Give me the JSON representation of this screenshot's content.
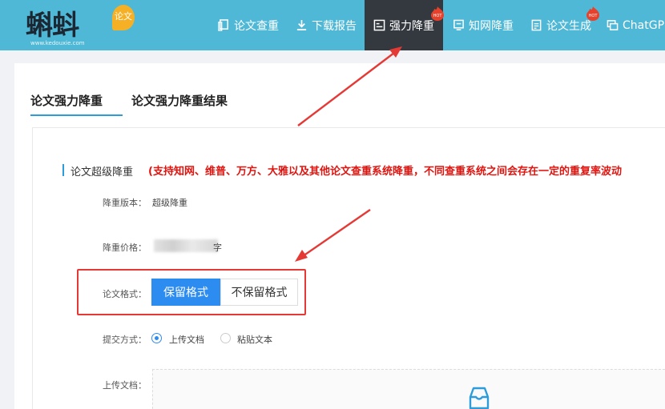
{
  "header": {
    "logo_text": "蝌蚪",
    "logo_badge": "论文",
    "logo_sub": "www.kedouxie.com",
    "nav": [
      {
        "label": "论文查重",
        "icon": "document-copy-icon",
        "active": false,
        "hot": false
      },
      {
        "label": "下载报告",
        "icon": "download-icon",
        "active": false,
        "hot": false
      },
      {
        "label": "强力降重",
        "icon": "reduce-icon",
        "active": true,
        "hot": true
      },
      {
        "label": "知网降重",
        "icon": "monitor-doc-icon",
        "active": false,
        "hot": false
      },
      {
        "label": "论文生成",
        "icon": "doc-generate-icon",
        "active": false,
        "hot": true
      },
      {
        "label": "ChatGP",
        "icon": "chat-icon",
        "active": false,
        "hot": false
      }
    ],
    "hot_label": "HOT"
  },
  "tabs": [
    {
      "label": "论文强力降重",
      "active": true
    },
    {
      "label": "论文强力降重结果",
      "active": false
    }
  ],
  "section": {
    "title": "论文超级降重",
    "note": "(支持知网、维普、万方、大雅以及其他论文查重系统降重，不同查重系统之间会存在一定的重复率波动"
  },
  "form": {
    "version_label": "降重版本：",
    "version_value": "超级降重",
    "price_label": "降重价格：",
    "price_value": "字",
    "format_label": "论文格式：",
    "format_options": [
      "保留格式",
      "不保留格式"
    ],
    "format_selected": "保留格式",
    "submit_label": "提交方式：",
    "submit_options": [
      "上传文档",
      "粘贴文本"
    ],
    "submit_selected": "上传文档",
    "upload_label": "上传文档："
  },
  "colors": {
    "header_bg": "#4fb8d6",
    "nav_active_bg": "#34393f",
    "accent": "#2d8cf0",
    "note_red": "#e0140f",
    "annotation_red": "#e53935"
  }
}
